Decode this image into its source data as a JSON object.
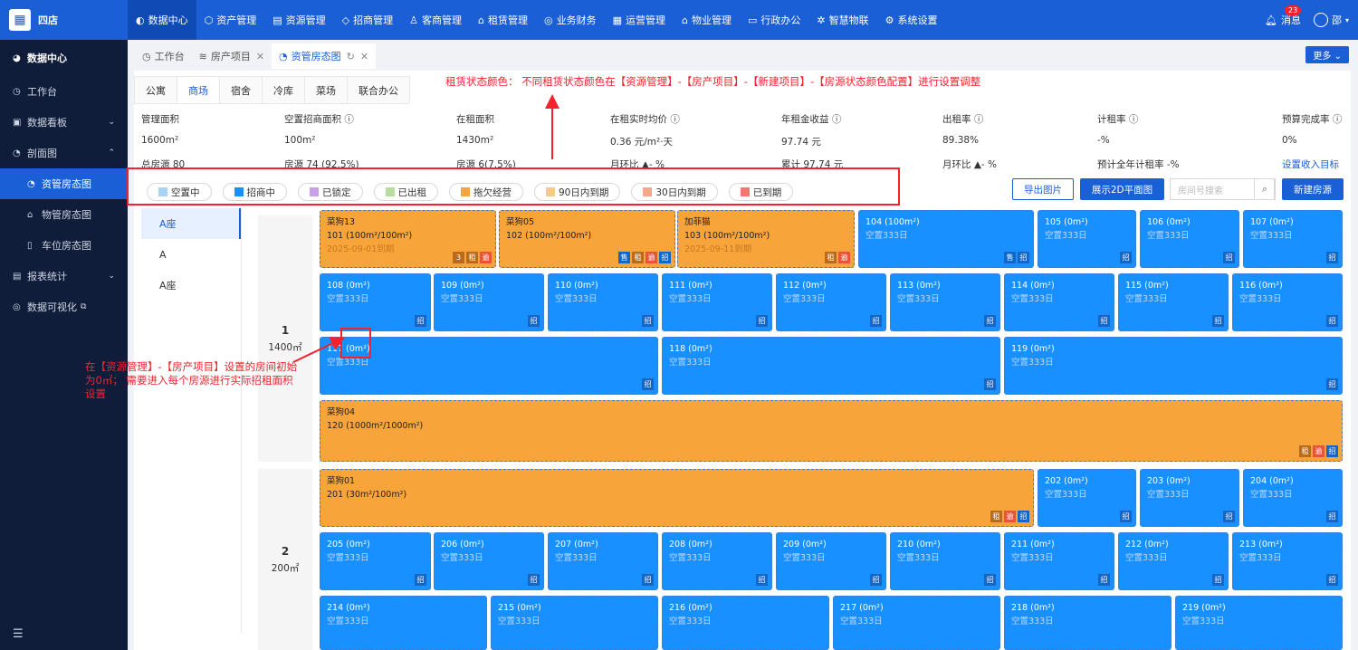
{
  "app": {
    "name": "四店"
  },
  "topnav": {
    "items": [
      {
        "label": "数据中心",
        "icon": "◐"
      },
      {
        "label": "资产管理",
        "icon": "⬡"
      },
      {
        "label": "资源管理",
        "icon": "▤"
      },
      {
        "label": "招商管理",
        "icon": "◇"
      },
      {
        "label": "客商管理",
        "icon": "♙"
      },
      {
        "label": "租赁管理",
        "icon": "⌂"
      },
      {
        "label": "业务财务",
        "icon": "◎"
      },
      {
        "label": "运营管理",
        "icon": "▦"
      },
      {
        "label": "物业管理",
        "icon": "⌂"
      },
      {
        "label": "行政办公",
        "icon": "▭"
      },
      {
        "label": "智慧物联",
        "icon": "✲"
      },
      {
        "label": "系统设置",
        "icon": "⚙"
      }
    ],
    "messages_label": "消息",
    "messages_count": "23",
    "user": "邵"
  },
  "sidebar": {
    "header": "数据中心",
    "items": [
      {
        "label": "工作台"
      },
      {
        "label": "数据看板"
      },
      {
        "label": "剖面图"
      },
      {
        "label": "资管房态图"
      },
      {
        "label": "物管房态图"
      },
      {
        "label": "车位房态图"
      },
      {
        "label": "报表统计"
      },
      {
        "label": "数据可视化"
      }
    ]
  },
  "tabs": [
    {
      "label": "工作台"
    },
    {
      "label": "房产项目"
    },
    {
      "label": "资管房态图"
    }
  ],
  "more_label": "更多",
  "subtabs": [
    "公寓",
    "商场",
    "宿舍",
    "冷库",
    "菜场",
    "联合办公"
  ],
  "note_top": "租赁状态颜色：  不同租赁状态颜色在【资源管理】-【房产项目】-【新建项目】-【房源状态颜色配置】进行设置调整",
  "stats": {
    "headers": [
      "管理面积",
      "空置招商面积",
      "在租面积",
      "在租实时均价",
      "年租金收益",
      "出租率",
      "计租率",
      "预算完成率"
    ],
    "values": [
      "1600m²",
      "100m²",
      "1430m²",
      "0.36 元/m²·天",
      "97.74 元",
      "89.38%",
      "-%",
      "0%"
    ],
    "row3": [
      "总房源 80",
      "房源 74 (92.5%)",
      "房源 6(7.5%)",
      "月环比 ▲- %",
      "累计 97.74 元",
      "月环比 ▲- %",
      "预计全年计租率 -%",
      "设置收入目标"
    ]
  },
  "legend": [
    {
      "label": "空置中",
      "color": "#a9d3f5"
    },
    {
      "label": "招商中",
      "color": "#1890ff"
    },
    {
      "label": "已锁定",
      "color": "#c9a0e8"
    },
    {
      "label": "已出租",
      "color": "#b8dca0"
    },
    {
      "label": "拖欠经营",
      "color": "#f7a43a"
    },
    {
      "label": "90日内到期",
      "color": "#f7c98a"
    },
    {
      "label": "30日内到期",
      "color": "#f5a889"
    },
    {
      "label": "已到期",
      "color": "#f07870"
    }
  ],
  "buttons": {
    "export": "导出图片",
    "plan2d": "展示2D平面图",
    "search_placeholder": "房间号搜索",
    "new_room": "新建房源"
  },
  "buildings": [
    "A座",
    "A",
    "A座"
  ],
  "floors": [
    {
      "name": "1",
      "area": "1400㎡"
    },
    {
      "name": "2",
      "area": "200㎡"
    }
  ],
  "note_left": "在【资源管理】-【房产项目】设置的房间初始为0㎡；  需要进入每个房源进行实际招租面积设置",
  "rooms": [
    {
      "t1": "菜狗13",
      "t2": "101 (100m²/100m²)",
      "t3": "2025-09-01到期",
      "tags": [
        "3",
        "租",
        "逾"
      ]
    },
    {
      "t1": "菜狗05",
      "t2": "102 (100m²/100m²)",
      "t3": "",
      "tags": [
        "售",
        "租",
        "逾",
        "招"
      ]
    },
    {
      "t1": "加菲猫",
      "t2": "103 (100m²/100m²)",
      "t3": "2025-09-11到期",
      "tags": [
        "租",
        "逾"
      ]
    },
    {
      "t1": "104 (100m²)",
      "t2": "空置333日",
      "t3": "",
      "tags": [
        "售",
        "招"
      ]
    },
    {
      "t1": "105 (0m²)",
      "t2": "空置333日",
      "t3": "",
      "tags": [
        "招"
      ]
    },
    {
      "t1": "106 (0m²)",
      "t2": "空置333日",
      "t3": "",
      "tags": [
        "招"
      ]
    },
    {
      "t1": "107 (0m²)",
      "t2": "空置333日",
      "t3": "",
      "tags": [
        "招"
      ]
    },
    {
      "t1": "108 (0m²)",
      "t2": "空置333日",
      "t3": "",
      "tags": [
        "招"
      ]
    },
    {
      "t1": "109 (0m²)",
      "t2": "空置333日",
      "t3": "",
      "tags": [
        "招"
      ]
    },
    {
      "t1": "110 (0m²)",
      "t2": "空置333日",
      "t3": "",
      "tags": [
        "招"
      ]
    },
    {
      "t1": "111 (0m²)",
      "t2": "空置333日",
      "t3": "",
      "tags": [
        "招"
      ]
    },
    {
      "t1": "112 (0m²)",
      "t2": "空置333日",
      "t3": "",
      "tags": [
        "招"
      ]
    },
    {
      "t1": "113 (0m²)",
      "t2": "空置333日",
      "t3": "",
      "tags": [
        "招"
      ]
    },
    {
      "t1": "114 (0m²)",
      "t2": "空置333日",
      "t3": "",
      "tags": [
        "招"
      ]
    },
    {
      "t1": "115 (0m²)",
      "t2": "空置333日",
      "t3": "",
      "tags": [
        "招"
      ]
    },
    {
      "t1": "116 (0m²)",
      "t2": "空置333日",
      "t3": "",
      "tags": [
        "招"
      ]
    },
    {
      "t1": "117 (0m²)",
      "t2": "空置333日",
      "t3": "",
      "tags": [
        "招"
      ]
    },
    {
      "t1": "118 (0m²)",
      "t2": "空置333日",
      "t3": "",
      "tags": [
        "招"
      ]
    },
    {
      "t1": "119 (0m²)",
      "t2": "空置333日",
      "t3": "",
      "tags": [
        "招"
      ]
    },
    {
      "t1": "菜狗04",
      "t2": "120 (1000m²/1000m²)",
      "t3": "",
      "tags": [
        "租",
        "逾",
        "招"
      ]
    },
    {
      "t1": "菜狗01",
      "t2": "201 (30m²/100m²)",
      "t3": "",
      "tags": [
        "租",
        "逾",
        "招"
      ]
    },
    {
      "t1": "202 (0m²)",
      "t2": "空置333日",
      "t3": "",
      "tags": [
        "招"
      ]
    },
    {
      "t1": "203 (0m²)",
      "t2": "空置333日",
      "t3": "",
      "tags": [
        "招"
      ]
    },
    {
      "t1": "204 (0m²)",
      "t2": "空置333日",
      "t3": "",
      "tags": [
        "招"
      ]
    },
    {
      "t1": "205 (0m²)",
      "t2": "空置333日",
      "t3": "",
      "tags": [
        "招"
      ]
    },
    {
      "t1": "206 (0m²)",
      "t2": "空置333日",
      "t3": "",
      "tags": [
        "招"
      ]
    },
    {
      "t1": "207 (0m²)",
      "t2": "空置333日",
      "t3": "",
      "tags": [
        "招"
      ]
    },
    {
      "t1": "208 (0m²)",
      "t2": "空置333日",
      "t3": "",
      "tags": [
        "招"
      ]
    },
    {
      "t1": "209 (0m²)",
      "t2": "空置333日",
      "t3": "",
      "tags": [
        "招"
      ]
    },
    {
      "t1": "210 (0m²)",
      "t2": "空置333日",
      "t3": "",
      "tags": [
        "招"
      ]
    },
    {
      "t1": "211 (0m²)",
      "t2": "空置333日",
      "t3": "",
      "tags": [
        "招"
      ]
    },
    {
      "t1": "212 (0m²)",
      "t2": "空置333日",
      "t3": "",
      "tags": [
        "招"
      ]
    },
    {
      "t1": "213 (0m²)",
      "t2": "空置333日",
      "t3": "",
      "tags": [
        "招"
      ]
    },
    {
      "t1": "214 (0m²)",
      "t2": "空置333日",
      "t3": "",
      "tags": []
    },
    {
      "t1": "215 (0m²)",
      "t2": "空置333日",
      "t3": "",
      "tags": []
    },
    {
      "t1": "216 (0m²)",
      "t2": "空置333日",
      "t3": "",
      "tags": []
    },
    {
      "t1": "217 (0m²)",
      "t2": "空置333日",
      "t3": "",
      "tags": []
    },
    {
      "t1": "218 (0m²)",
      "t2": "空置333日",
      "t3": "",
      "tags": []
    },
    {
      "t1": "219 (0m²)",
      "t2": "空置333日",
      "t3": "",
      "tags": []
    }
  ]
}
